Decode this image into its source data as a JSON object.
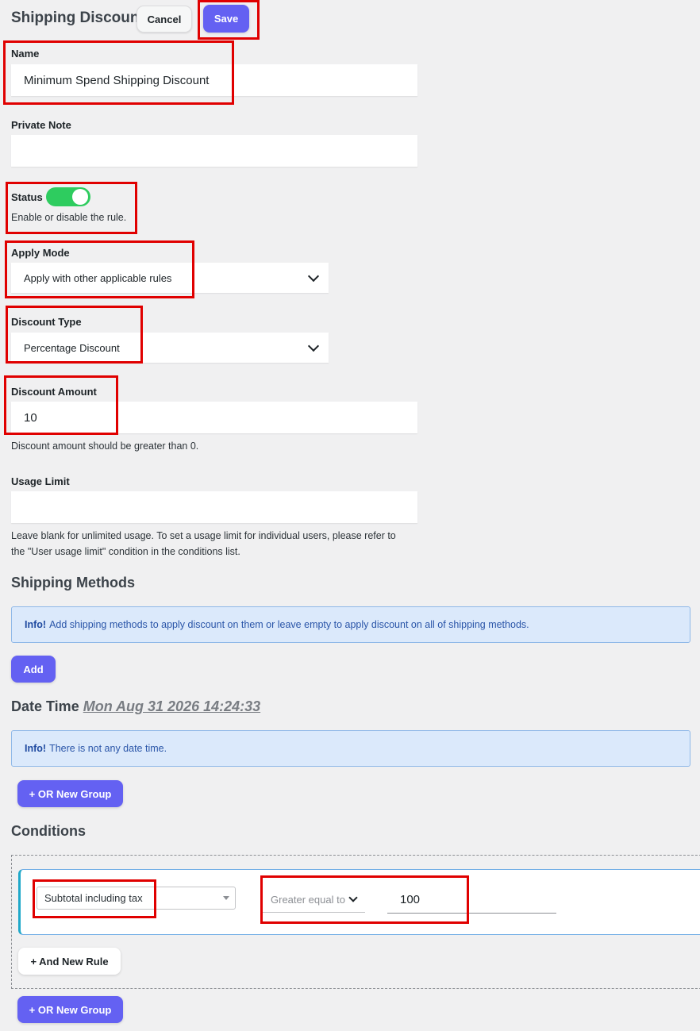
{
  "header": {
    "title": "Shipping Discount",
    "cancel_label": "Cancel",
    "save_label": "Save"
  },
  "form": {
    "name": {
      "label": "Name",
      "value": "Minimum Spend Shipping Discount"
    },
    "private_note": {
      "label": "Private Note",
      "value": ""
    },
    "status": {
      "label": "Status",
      "enabled": true,
      "help": "Enable or disable the rule."
    },
    "apply_mode": {
      "label": "Apply Mode",
      "value": "Apply with other applicable rules"
    },
    "discount_type": {
      "label": "Discount Type",
      "value": "Percentage Discount"
    },
    "discount_amount": {
      "label": "Discount Amount",
      "value": "10",
      "help": "Discount amount should be greater than 0."
    },
    "usage_limit": {
      "label": "Usage Limit",
      "value": "",
      "help_line1": "Leave blank for unlimited usage. To set a usage limit for individual users, please refer to",
      "help_line2": "the \"User usage limit\" condition in the conditions list."
    }
  },
  "shipping_methods": {
    "title": "Shipping Methods",
    "info_prefix": "Info!",
    "info_text": "Add shipping methods to apply discount on them or leave empty to apply discount on all of shipping methods.",
    "add_label": "Add"
  },
  "date_time": {
    "title": "Date Time",
    "value": "Mon Aug 31 2026 14:24:33",
    "info_prefix": "Info!",
    "info_text": "There is not any date time.",
    "or_group_label": "+ OR New Group"
  },
  "conditions": {
    "title": "Conditions",
    "rule": {
      "field": "Subtotal including tax",
      "operator": "Greater equal to",
      "value": "100"
    },
    "and_rule_label": "+ And New Rule",
    "or_group_label": "+ OR New Group"
  },
  "colors": {
    "primary": "#6461f2",
    "toggle_on": "#2ecc5f",
    "highlight": "#e00000",
    "info_bg": "#dbe9fb"
  }
}
